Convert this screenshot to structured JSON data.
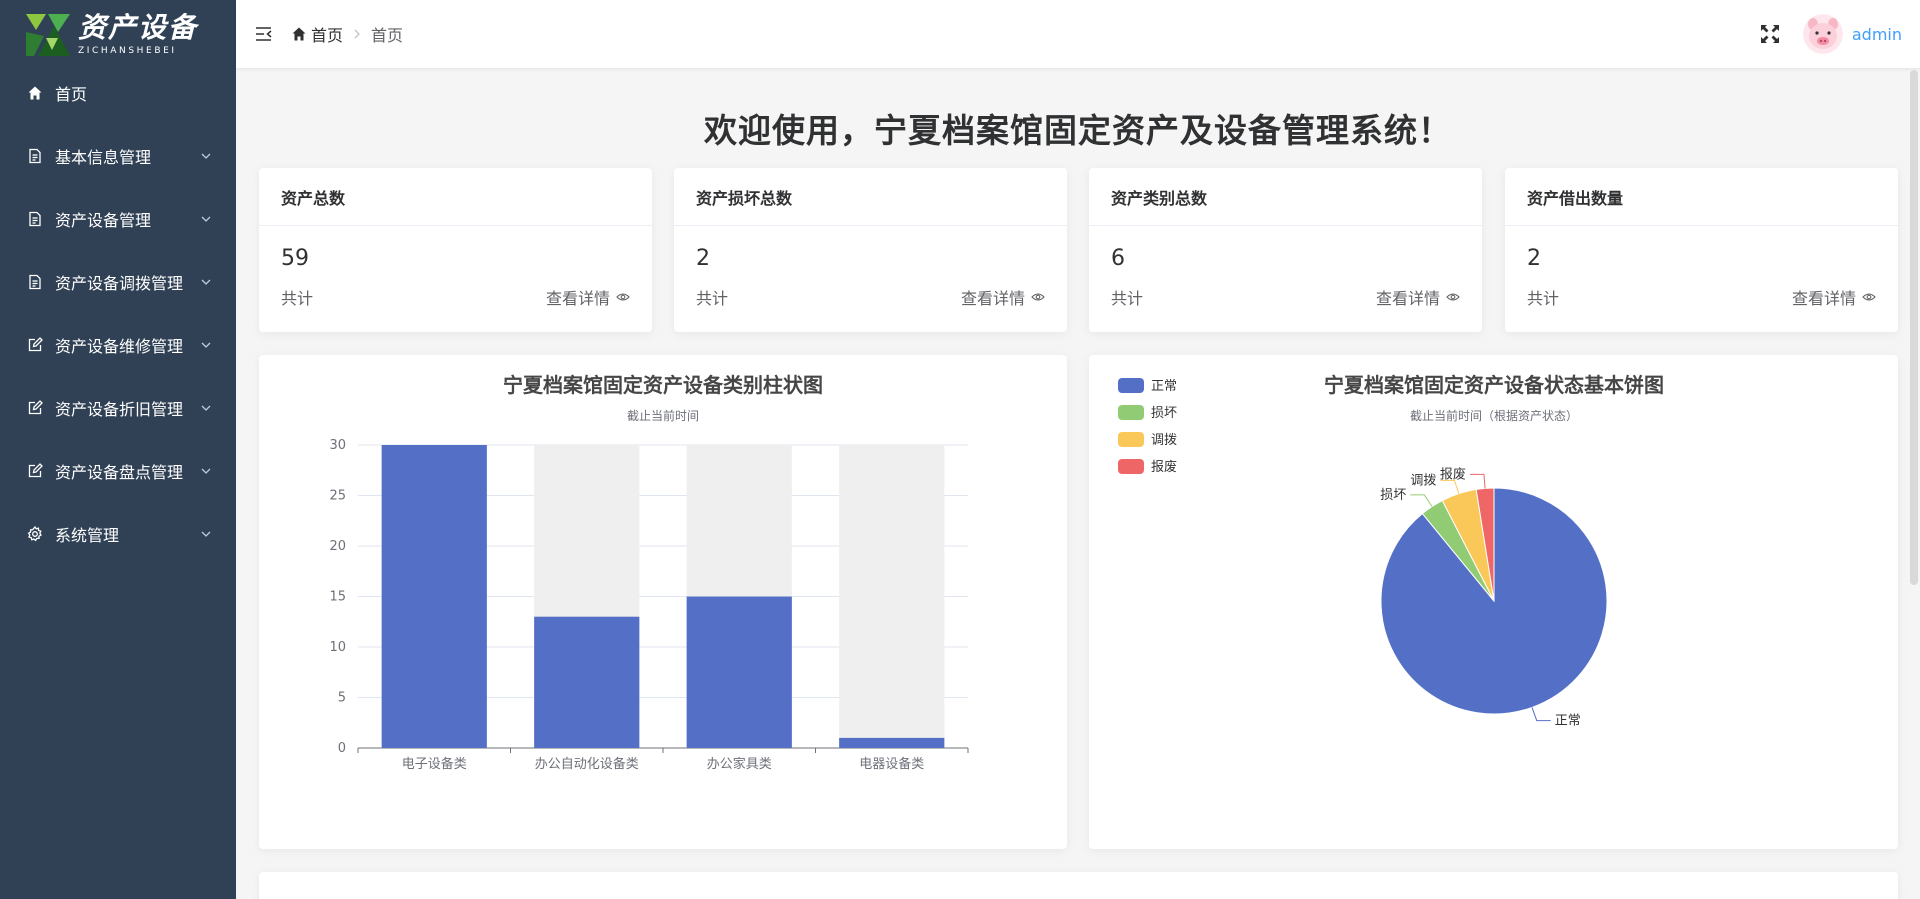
{
  "logo": {
    "title": "资产设备",
    "subtitle": "ZICHANSHEBEI"
  },
  "sidebar": {
    "items": [
      {
        "label": "首页",
        "icon": "home-icon"
      },
      {
        "label": "基本信息管理",
        "icon": "document-icon"
      },
      {
        "label": "资产设备管理",
        "icon": "document-icon"
      },
      {
        "label": "资产设备调拨管理",
        "icon": "document-icon"
      },
      {
        "label": "资产设备维修管理",
        "icon": "edit-icon"
      },
      {
        "label": "资产设备折旧管理",
        "icon": "edit-icon"
      },
      {
        "label": "资产设备盘点管理",
        "icon": "edit-icon"
      },
      {
        "label": "系统管理",
        "icon": "gear-icon"
      }
    ]
  },
  "header": {
    "breadcrumb": {
      "home": "首页",
      "current": "首页"
    },
    "user": "admin"
  },
  "welcome": "欢迎使用，宁夏档案馆固定资产及设备管理系统！",
  "stats": [
    {
      "title": "资产总数",
      "value": "59",
      "footer": "共计",
      "link": "查看详情"
    },
    {
      "title": "资产损坏总数",
      "value": "2",
      "footer": "共计",
      "link": "查看详情"
    },
    {
      "title": "资产类别总数",
      "value": "6",
      "footer": "共计",
      "link": "查看详情"
    },
    {
      "title": "资产借出数量",
      "value": "2",
      "footer": "共计",
      "link": "查看详情"
    }
  ],
  "colors": {
    "primary": "#5470c6",
    "sidebar": "#304156",
    "link": "#409eff"
  },
  "chart_data": [
    {
      "type": "bar",
      "title": "宁夏档案馆固定资产设备类别柱状图",
      "subtitle": "截止当前时间",
      "categories": [
        "电子设备类",
        "办公自动化设备类",
        "办公家具类",
        "电器设备类"
      ],
      "values": [
        30,
        13,
        15,
        1
      ],
      "ylim": [
        0,
        30
      ],
      "yticks": [
        0,
        5,
        10,
        15,
        20,
        25,
        30
      ],
      "background_bars": true,
      "color": "#5470c6"
    },
    {
      "type": "pie",
      "title": "宁夏档案馆固定资产设备状态基本饼图",
      "subtitle": "截止当前时间（根据资产状态）",
      "legend_position": "top-left",
      "slices": [
        {
          "name": "正常",
          "value": 53,
          "color": "#5470c6"
        },
        {
          "name": "损坏",
          "value": 2,
          "color": "#91cc75"
        },
        {
          "name": "调拨",
          "value": 3,
          "color": "#fac858"
        },
        {
          "name": "报废",
          "value": 1.5,
          "color": "#ee6666"
        }
      ]
    }
  ]
}
